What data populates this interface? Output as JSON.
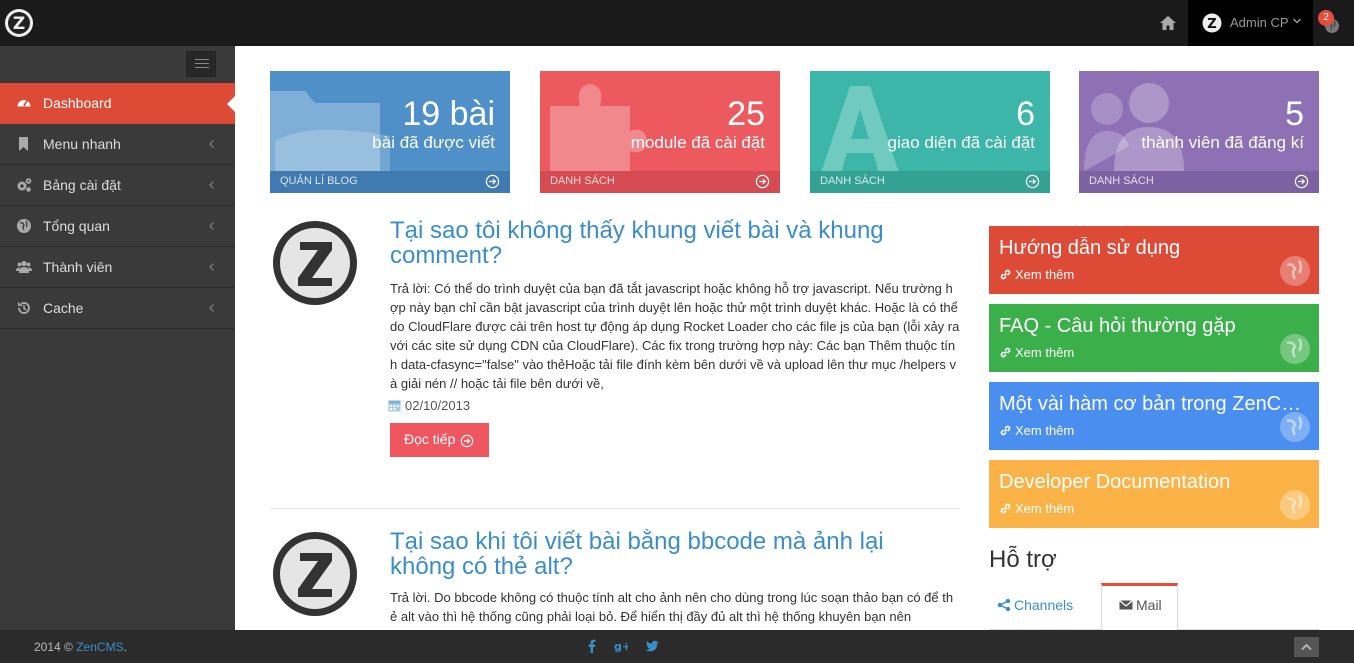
{
  "topbar": {
    "user_name": "Admin CP",
    "notification_count": "2"
  },
  "sidebar": {
    "items": [
      {
        "label": "Dashboard"
      },
      {
        "label": "Menu nhanh"
      },
      {
        "label": "Bảng cài đặt"
      },
      {
        "label": "Tổng quan"
      },
      {
        "label": "Thành viên"
      },
      {
        "label": "Cache"
      }
    ]
  },
  "tiles": [
    {
      "number": "19 bài",
      "desc": "bài đã được viết",
      "footer": "QUẢN LÍ BLOG",
      "color": "#3e87c7"
    },
    {
      "number": "25",
      "desc": "module đã cài đặt",
      "footer": "DANH SÁCH",
      "color": "#ec5a5f"
    },
    {
      "number": "6",
      "desc": "giao diện đã cài đặt",
      "footer": "DANH SÁCH",
      "color": "#3bb6a8"
    },
    {
      "number": "5",
      "desc": "thành viên đã đăng kí",
      "footer": "DANH SÁCH",
      "color": "#8e70b5"
    }
  ],
  "posts": [
    {
      "title": "Tại sao tôi không thấy khung viết bài và khung comment?",
      "body": "Trả lời: Có thể do trình duyệt của bạn đã tắt javascript hoặc không hỗ trợ javascript. Nếu trường hợp này bạn chỉ cần bật javascript của trình duyệt lên hoặc thử một trình duyệt khác. Hoặc là có thể do CloudFlare được cài trên host tự động áp dụng Rocket Loader cho các file js của bạn (lỗi xảy ra với các site sử dụng CDN của CloudFlare).  Các fix trong trường hợp này: Các bạn Thêm thuộc tính data-cfasync=\"false\" vào thẻHoặc tải file đính kèm bên dưới về và upload lên thư mục /helpers và giải nén // hoặc tải file bên dưới về,",
      "date": "02/10/2013",
      "read_more": "Đọc tiếp"
    },
    {
      "title": "Tại sao khi tôi viết bài bằng bbcode mà ảnh lại không có thẻ alt?",
      "body": "Trả lời. Do bbcode không có thuộc tính alt cho ảnh nên cho dùng trong lúc soạn thảo bạn có để thẻ alt vào thì hệ thống cũng phải loại bỏ. Để hiển thị đầy đủ alt thì hệ thống khuyên bạn nên"
    }
  ],
  "right_boxes": [
    {
      "title": "Hướng dẫn sử dụng",
      "link": "Xem thêm",
      "color": "#dd4a36"
    },
    {
      "title": "FAQ - Câu hỏi thường gặp",
      "link": "Xem thêm",
      "color": "#3bb04a"
    },
    {
      "title": "Một vài hàm cơ bản trong ZenCMS ...",
      "link": "Xem thêm",
      "color": "#4a8ef0"
    },
    {
      "title": "Developer Documentation",
      "link": "Xem thêm",
      "color": "#fbb347"
    }
  ],
  "support": {
    "title": "Hỗ trợ",
    "tabs": [
      {
        "label": "Channels"
      },
      {
        "label": "Mail"
      }
    ]
  },
  "footer": {
    "copyright": "2014 © ",
    "brand": "ZenCMS",
    "suffix": "."
  }
}
